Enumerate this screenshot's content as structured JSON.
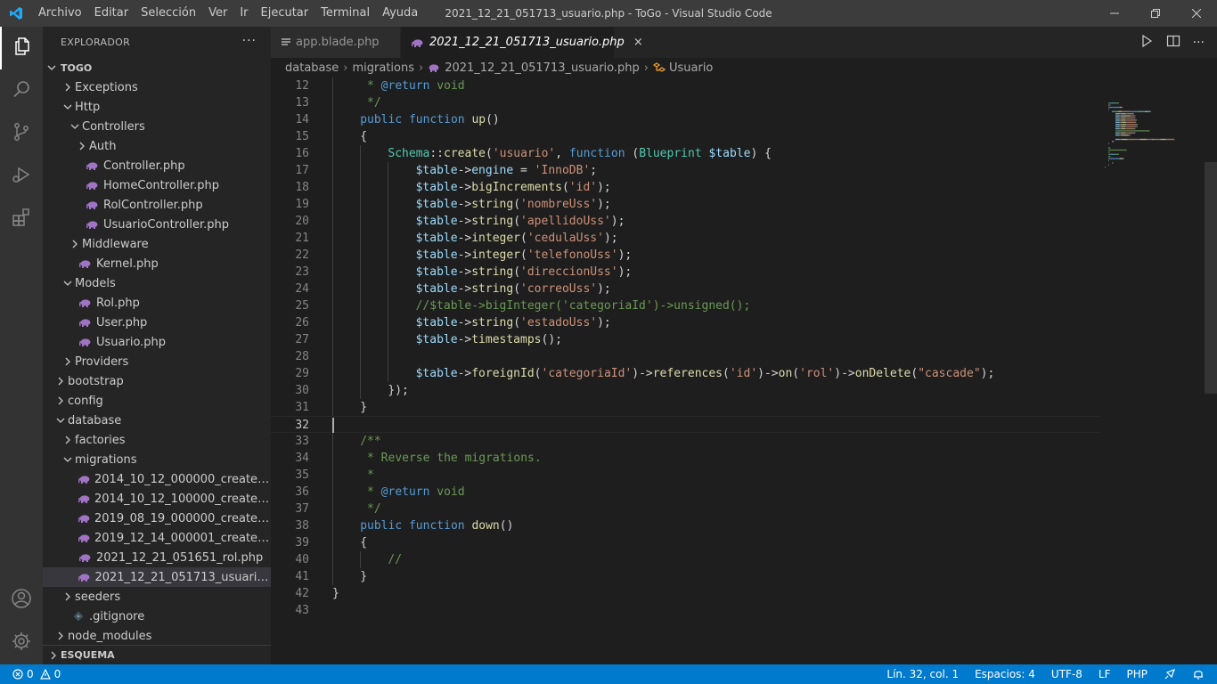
{
  "titlebar": {
    "menu": [
      "Archivo",
      "Editar",
      "Selección",
      "Ver",
      "Ir",
      "Ejecutar",
      "Terminal",
      "Ayuda"
    ],
    "window_title": "2021_12_21_051713_usuario.php - ToGo - Visual Studio Code"
  },
  "sidebar": {
    "title": "EXPLORADOR",
    "more": "···",
    "project": "TOGO",
    "outline": "ESQUEMA",
    "tree": [
      {
        "label": "Exceptions",
        "depth": 2,
        "kind": "folder",
        "open": false
      },
      {
        "label": "Http",
        "depth": 2,
        "kind": "folder",
        "open": true
      },
      {
        "label": "Controllers",
        "depth": 3,
        "kind": "folder",
        "open": true
      },
      {
        "label": "Auth",
        "depth": 4,
        "kind": "folder",
        "open": false
      },
      {
        "label": "Controller.php",
        "depth": 4,
        "kind": "php"
      },
      {
        "label": "HomeController.php",
        "depth": 4,
        "kind": "php"
      },
      {
        "label": "RolController.php",
        "depth": 4,
        "kind": "php"
      },
      {
        "label": "UsuarioController.php",
        "depth": 4,
        "kind": "php"
      },
      {
        "label": "Middleware",
        "depth": 3,
        "kind": "folder",
        "open": false
      },
      {
        "label": "Kernel.php",
        "depth": 3,
        "kind": "php"
      },
      {
        "label": "Models",
        "depth": 2,
        "kind": "folder",
        "open": true
      },
      {
        "label": "Rol.php",
        "depth": 3,
        "kind": "php"
      },
      {
        "label": "User.php",
        "depth": 3,
        "kind": "php"
      },
      {
        "label": "Usuario.php",
        "depth": 3,
        "kind": "php"
      },
      {
        "label": "Providers",
        "depth": 2,
        "kind": "folder",
        "open": false
      },
      {
        "label": "bootstrap",
        "depth": 1,
        "kind": "folder",
        "open": false
      },
      {
        "label": "config",
        "depth": 1,
        "kind": "folder",
        "open": false
      },
      {
        "label": "database",
        "depth": 1,
        "kind": "folder",
        "open": true
      },
      {
        "label": "factories",
        "depth": 2,
        "kind": "folder",
        "open": false
      },
      {
        "label": "migrations",
        "depth": 2,
        "kind": "folder",
        "open": true
      },
      {
        "label": "2014_10_12_000000_create_users_...",
        "depth": 3,
        "kind": "php"
      },
      {
        "label": "2014_10_12_100000_create_passw...",
        "depth": 3,
        "kind": "php"
      },
      {
        "label": "2019_08_19_000000_create_failed_...",
        "depth": 3,
        "kind": "php"
      },
      {
        "label": "2019_12_14_000001_create_perso...",
        "depth": 3,
        "kind": "php"
      },
      {
        "label": "2021_12_21_051651_rol.php",
        "depth": 3,
        "kind": "php"
      },
      {
        "label": "2021_12_21_051713_usuario.php",
        "depth": 3,
        "kind": "php",
        "selected": true
      },
      {
        "label": "seeders",
        "depth": 2,
        "kind": "folder",
        "open": false
      },
      {
        "label": ".gitignore",
        "depth": 2,
        "kind": "git"
      },
      {
        "label": "node_modules",
        "depth": 1,
        "kind": "folder",
        "open": false
      }
    ]
  },
  "tabs": [
    {
      "label": "app.blade.php",
      "icon": "file-lines-icon",
      "active": false
    },
    {
      "label": "2021_12_21_051713_usuario.php",
      "icon": "php-elephant-icon",
      "active": true,
      "close": "×"
    }
  ],
  "breadcrumb": [
    "database",
    "migrations",
    "2021_12_21_051713_usuario.php",
    "Usuario"
  ],
  "editor": {
    "current_line": 32,
    "lines": [
      {
        "n": "12",
        "indent": 1,
        "tokens": [
          [
            " * ",
            "cmt"
          ],
          [
            "@return",
            "tag"
          ],
          [
            " void",
            "cmt"
          ]
        ]
      },
      {
        "n": "13",
        "indent": 1,
        "tokens": [
          [
            " */",
            "cmt"
          ]
        ]
      },
      {
        "n": "14",
        "indent": 1,
        "tokens": [
          [
            "public",
            "kw"
          ],
          [
            " ",
            "op"
          ],
          [
            "function",
            "kw"
          ],
          [
            " ",
            "op"
          ],
          [
            "up",
            "fn"
          ],
          [
            "()",
            "op"
          ]
        ]
      },
      {
        "n": "15",
        "indent": 1,
        "tokens": [
          [
            "{",
            "op"
          ]
        ]
      },
      {
        "n": "16",
        "indent": 2,
        "tokens": [
          [
            "Schema",
            "cls"
          ],
          [
            "::",
            "op"
          ],
          [
            "create",
            "fn"
          ],
          [
            "(",
            "op"
          ],
          [
            "'usuario'",
            "str"
          ],
          [
            ", ",
            "op"
          ],
          [
            "function",
            "kw"
          ],
          [
            " (",
            "op"
          ],
          [
            "Blueprint",
            "cls"
          ],
          [
            " ",
            "op"
          ],
          [
            "$table",
            "var"
          ],
          [
            ") {",
            "op"
          ]
        ]
      },
      {
        "n": "17",
        "indent": 3,
        "tokens": [
          [
            "$table",
            "var"
          ],
          [
            "->",
            "op"
          ],
          [
            "engine",
            "var"
          ],
          [
            " = ",
            "op"
          ],
          [
            "'InnoDB'",
            "str"
          ],
          [
            ";",
            "op"
          ]
        ]
      },
      {
        "n": "18",
        "indent": 3,
        "tokens": [
          [
            "$table",
            "var"
          ],
          [
            "->",
            "op"
          ],
          [
            "bigIncrements",
            "fn"
          ],
          [
            "(",
            "op"
          ],
          [
            "'id'",
            "str"
          ],
          [
            ");",
            "op"
          ]
        ]
      },
      {
        "n": "19",
        "indent": 3,
        "tokens": [
          [
            "$table",
            "var"
          ],
          [
            "->",
            "op"
          ],
          [
            "string",
            "fn"
          ],
          [
            "(",
            "op"
          ],
          [
            "'nombreUss'",
            "str"
          ],
          [
            ");",
            "op"
          ]
        ]
      },
      {
        "n": "20",
        "indent": 3,
        "tokens": [
          [
            "$table",
            "var"
          ],
          [
            "->",
            "op"
          ],
          [
            "string",
            "fn"
          ],
          [
            "(",
            "op"
          ],
          [
            "'apellidoUss'",
            "str"
          ],
          [
            ");",
            "op"
          ]
        ]
      },
      {
        "n": "21",
        "indent": 3,
        "tokens": [
          [
            "$table",
            "var"
          ],
          [
            "->",
            "op"
          ],
          [
            "integer",
            "fn"
          ],
          [
            "(",
            "op"
          ],
          [
            "'cedulaUss'",
            "str"
          ],
          [
            ");",
            "op"
          ]
        ]
      },
      {
        "n": "22",
        "indent": 3,
        "tokens": [
          [
            "$table",
            "var"
          ],
          [
            "->",
            "op"
          ],
          [
            "integer",
            "fn"
          ],
          [
            "(",
            "op"
          ],
          [
            "'telefonoUss'",
            "str"
          ],
          [
            ");",
            "op"
          ]
        ]
      },
      {
        "n": "23",
        "indent": 3,
        "tokens": [
          [
            "$table",
            "var"
          ],
          [
            "->",
            "op"
          ],
          [
            "string",
            "fn"
          ],
          [
            "(",
            "op"
          ],
          [
            "'direccionUss'",
            "str"
          ],
          [
            ");",
            "op"
          ]
        ]
      },
      {
        "n": "24",
        "indent": 3,
        "tokens": [
          [
            "$table",
            "var"
          ],
          [
            "->",
            "op"
          ],
          [
            "string",
            "fn"
          ],
          [
            "(",
            "op"
          ],
          [
            "'correoUss'",
            "str"
          ],
          [
            ");",
            "op"
          ]
        ]
      },
      {
        "n": "25",
        "indent": 3,
        "tokens": [
          [
            "//$table->bigInteger('categoriaId')->unsigned();",
            "cmt"
          ]
        ]
      },
      {
        "n": "26",
        "indent": 3,
        "tokens": [
          [
            "$table",
            "var"
          ],
          [
            "->",
            "op"
          ],
          [
            "string",
            "fn"
          ],
          [
            "(",
            "op"
          ],
          [
            "'estadoUss'",
            "str"
          ],
          [
            ");",
            "op"
          ]
        ]
      },
      {
        "n": "27",
        "indent": 3,
        "tokens": [
          [
            "$table",
            "var"
          ],
          [
            "->",
            "op"
          ],
          [
            "timestamps",
            "fn"
          ],
          [
            "();",
            "op"
          ]
        ]
      },
      {
        "n": "28",
        "indent": 3,
        "tokens": []
      },
      {
        "n": "29",
        "indent": 3,
        "tokens": [
          [
            "$table",
            "var"
          ],
          [
            "->",
            "op"
          ],
          [
            "foreignId",
            "fn"
          ],
          [
            "(",
            "op"
          ],
          [
            "'categoriaId'",
            "str"
          ],
          [
            ")->",
            "op"
          ],
          [
            "references",
            "fn"
          ],
          [
            "(",
            "op"
          ],
          [
            "'id'",
            "str"
          ],
          [
            ")->",
            "op"
          ],
          [
            "on",
            "fn"
          ],
          [
            "(",
            "op"
          ],
          [
            "'rol'",
            "str"
          ],
          [
            ")->",
            "op"
          ],
          [
            "onDelete",
            "fn"
          ],
          [
            "(",
            "op"
          ],
          [
            "\"cascade\"",
            "str"
          ],
          [
            ");",
            "op"
          ]
        ]
      },
      {
        "n": "30",
        "indent": 2,
        "tokens": [
          [
            "});",
            "op"
          ]
        ]
      },
      {
        "n": "31",
        "indent": 1,
        "tokens": [
          [
            "}",
            "op"
          ]
        ]
      },
      {
        "n": "32",
        "indent": 0,
        "tokens": []
      },
      {
        "n": "33",
        "indent": 1,
        "tokens": [
          [
            "/**",
            "cmt"
          ]
        ]
      },
      {
        "n": "34",
        "indent": 1,
        "tokens": [
          [
            " * Reverse the migrations.",
            "cmt"
          ]
        ]
      },
      {
        "n": "35",
        "indent": 1,
        "tokens": [
          [
            " *",
            "cmt"
          ]
        ]
      },
      {
        "n": "36",
        "indent": 1,
        "tokens": [
          [
            " * ",
            "cmt"
          ],
          [
            "@return",
            "tag"
          ],
          [
            " void",
            "cmt"
          ]
        ]
      },
      {
        "n": "37",
        "indent": 1,
        "tokens": [
          [
            " */",
            "cmt"
          ]
        ]
      },
      {
        "n": "38",
        "indent": 1,
        "tokens": [
          [
            "public",
            "kw"
          ],
          [
            " ",
            "op"
          ],
          [
            "function",
            "kw"
          ],
          [
            " ",
            "op"
          ],
          [
            "down",
            "fn"
          ],
          [
            "()",
            "op"
          ]
        ]
      },
      {
        "n": "39",
        "indent": 1,
        "tokens": [
          [
            "{",
            "op"
          ]
        ]
      },
      {
        "n": "40",
        "indent": 2,
        "tokens": [
          [
            "//",
            "cmt"
          ]
        ]
      },
      {
        "n": "41",
        "indent": 1,
        "tokens": [
          [
            "}",
            "op"
          ]
        ]
      },
      {
        "n": "42",
        "indent": 0,
        "tokens": [
          [
            "}",
            "op"
          ]
        ]
      },
      {
        "n": "43",
        "indent": 0,
        "tokens": []
      }
    ]
  },
  "statusbar": {
    "errors": "0",
    "warnings": "0",
    "position": "Lín. 32, col. 1",
    "spaces": "Espacios: 4",
    "encoding": "UTF-8",
    "eol": "LF",
    "language": "PHP"
  },
  "colors": {
    "accent": "#007acc",
    "php_icon": "#a074c4",
    "activity_icon": "#858585"
  }
}
